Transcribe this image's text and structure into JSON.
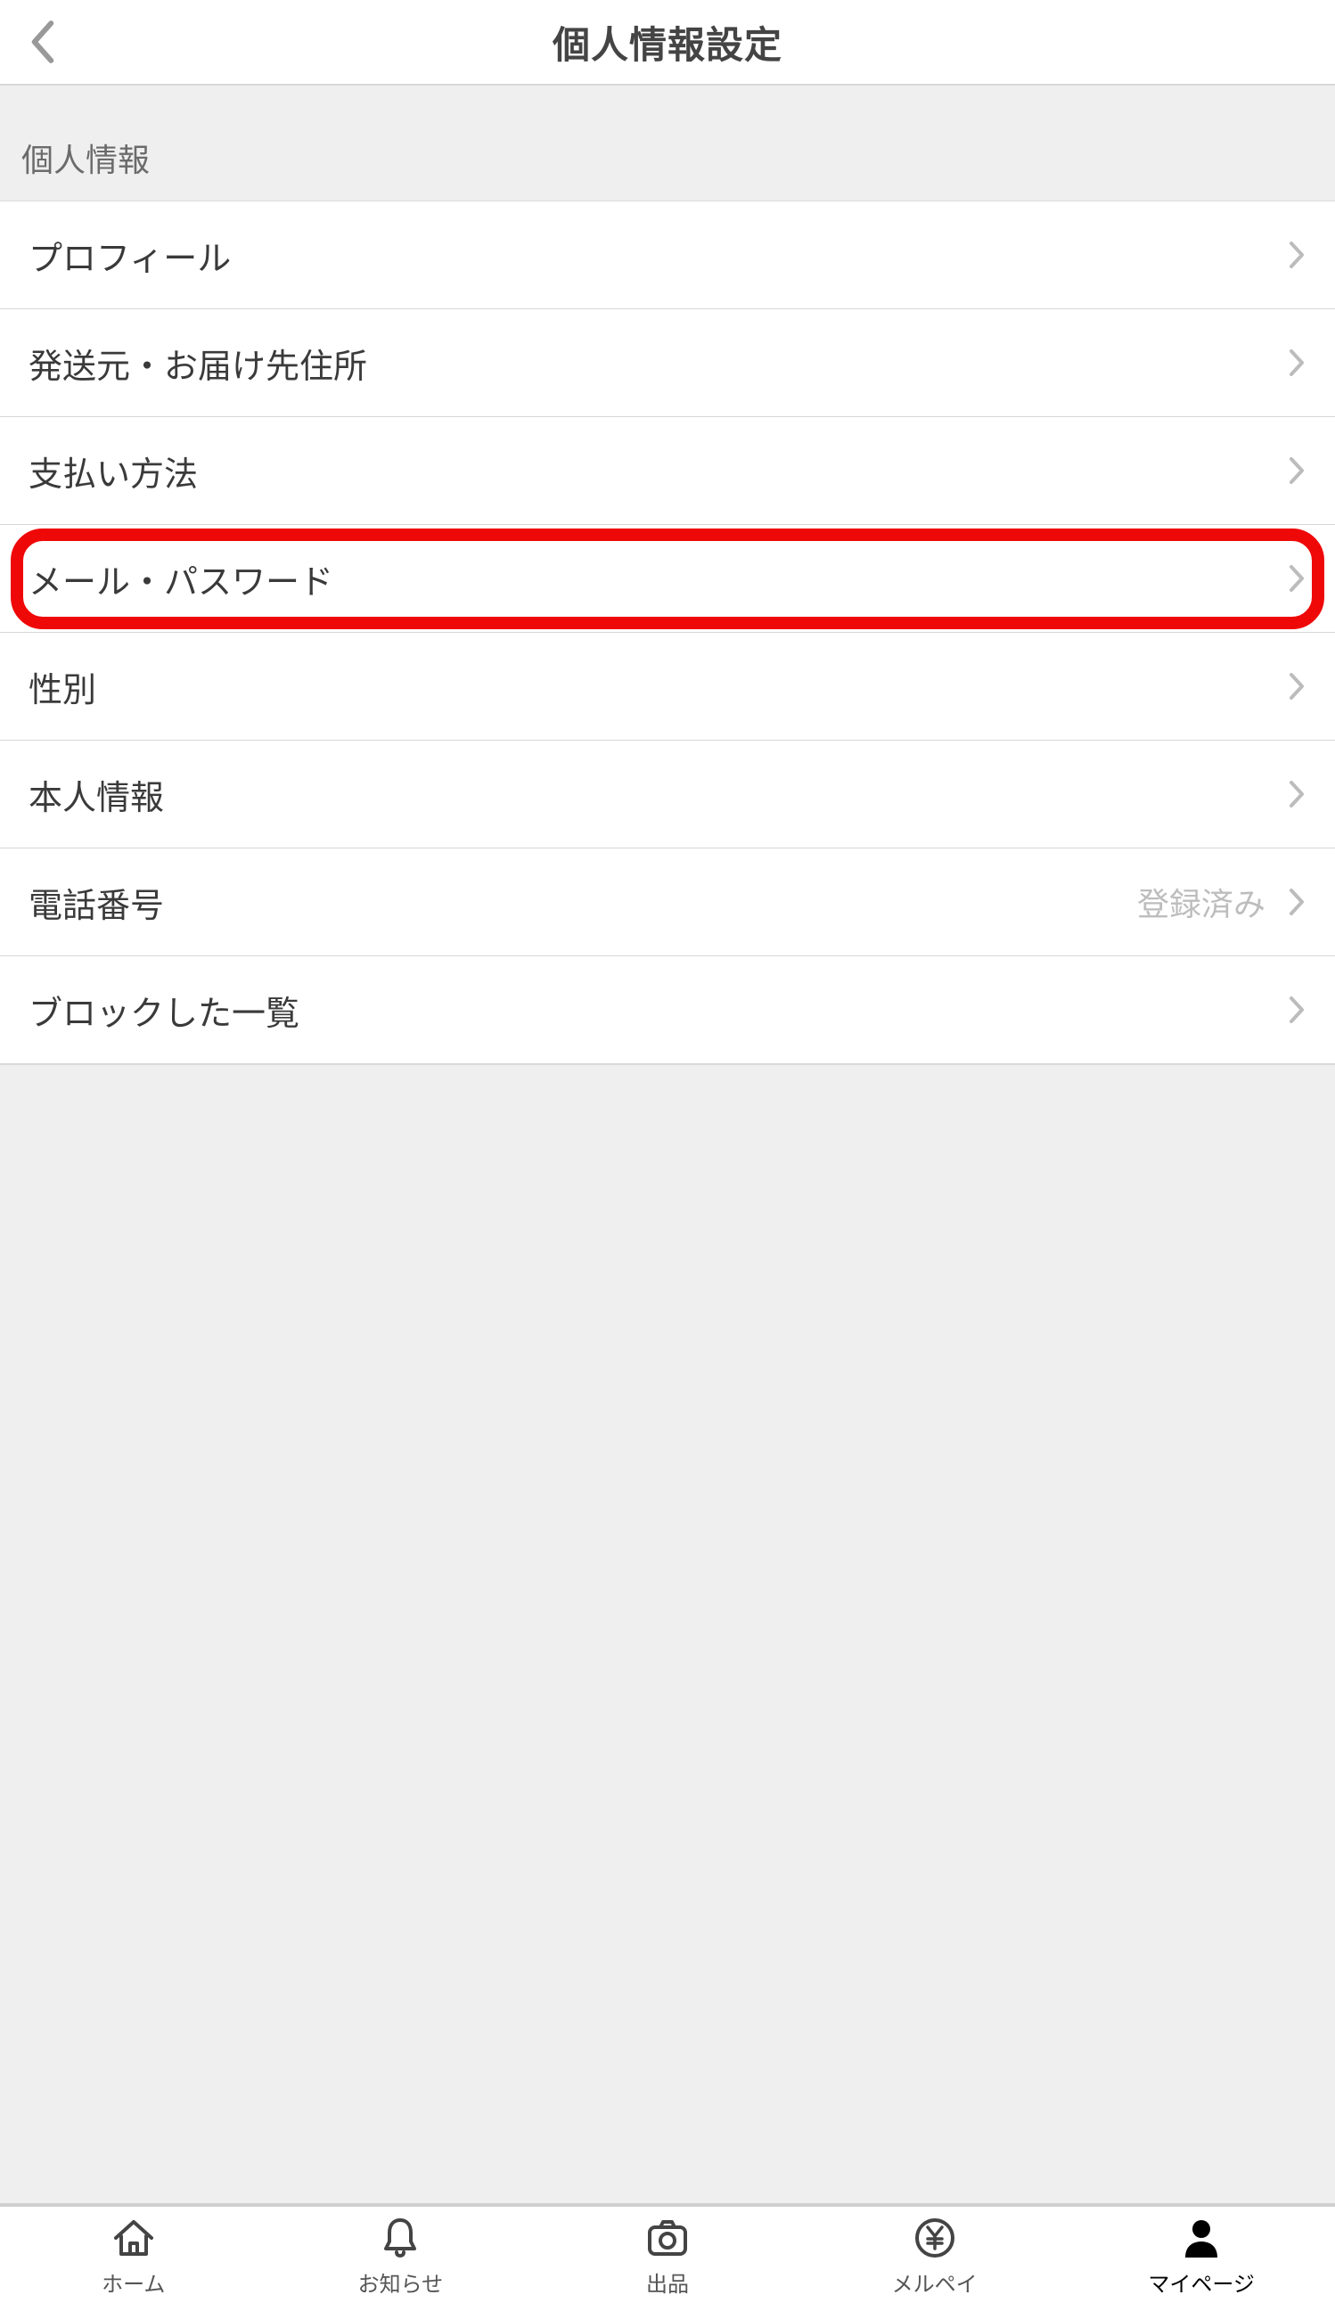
{
  "header": {
    "title": "個人情報設定"
  },
  "section_header": "個人情報",
  "rows": {
    "profile": {
      "label": "プロフィール"
    },
    "address": {
      "label": "発送元・お届け先住所"
    },
    "payment": {
      "label": "支払い方法"
    },
    "mail_pw": {
      "label": "メール・パスワード"
    },
    "gender": {
      "label": "性別"
    },
    "identity": {
      "label": "本人情報"
    },
    "phone": {
      "label": "電話番号",
      "status": "登録済み"
    },
    "blocked": {
      "label": "ブロックした一覧"
    }
  },
  "tabs": {
    "home": {
      "label": "ホーム"
    },
    "news": {
      "label": "お知らせ"
    },
    "sell": {
      "label": "出品"
    },
    "merpay": {
      "label": "メルペイ"
    },
    "mypage": {
      "label": "マイページ"
    }
  }
}
